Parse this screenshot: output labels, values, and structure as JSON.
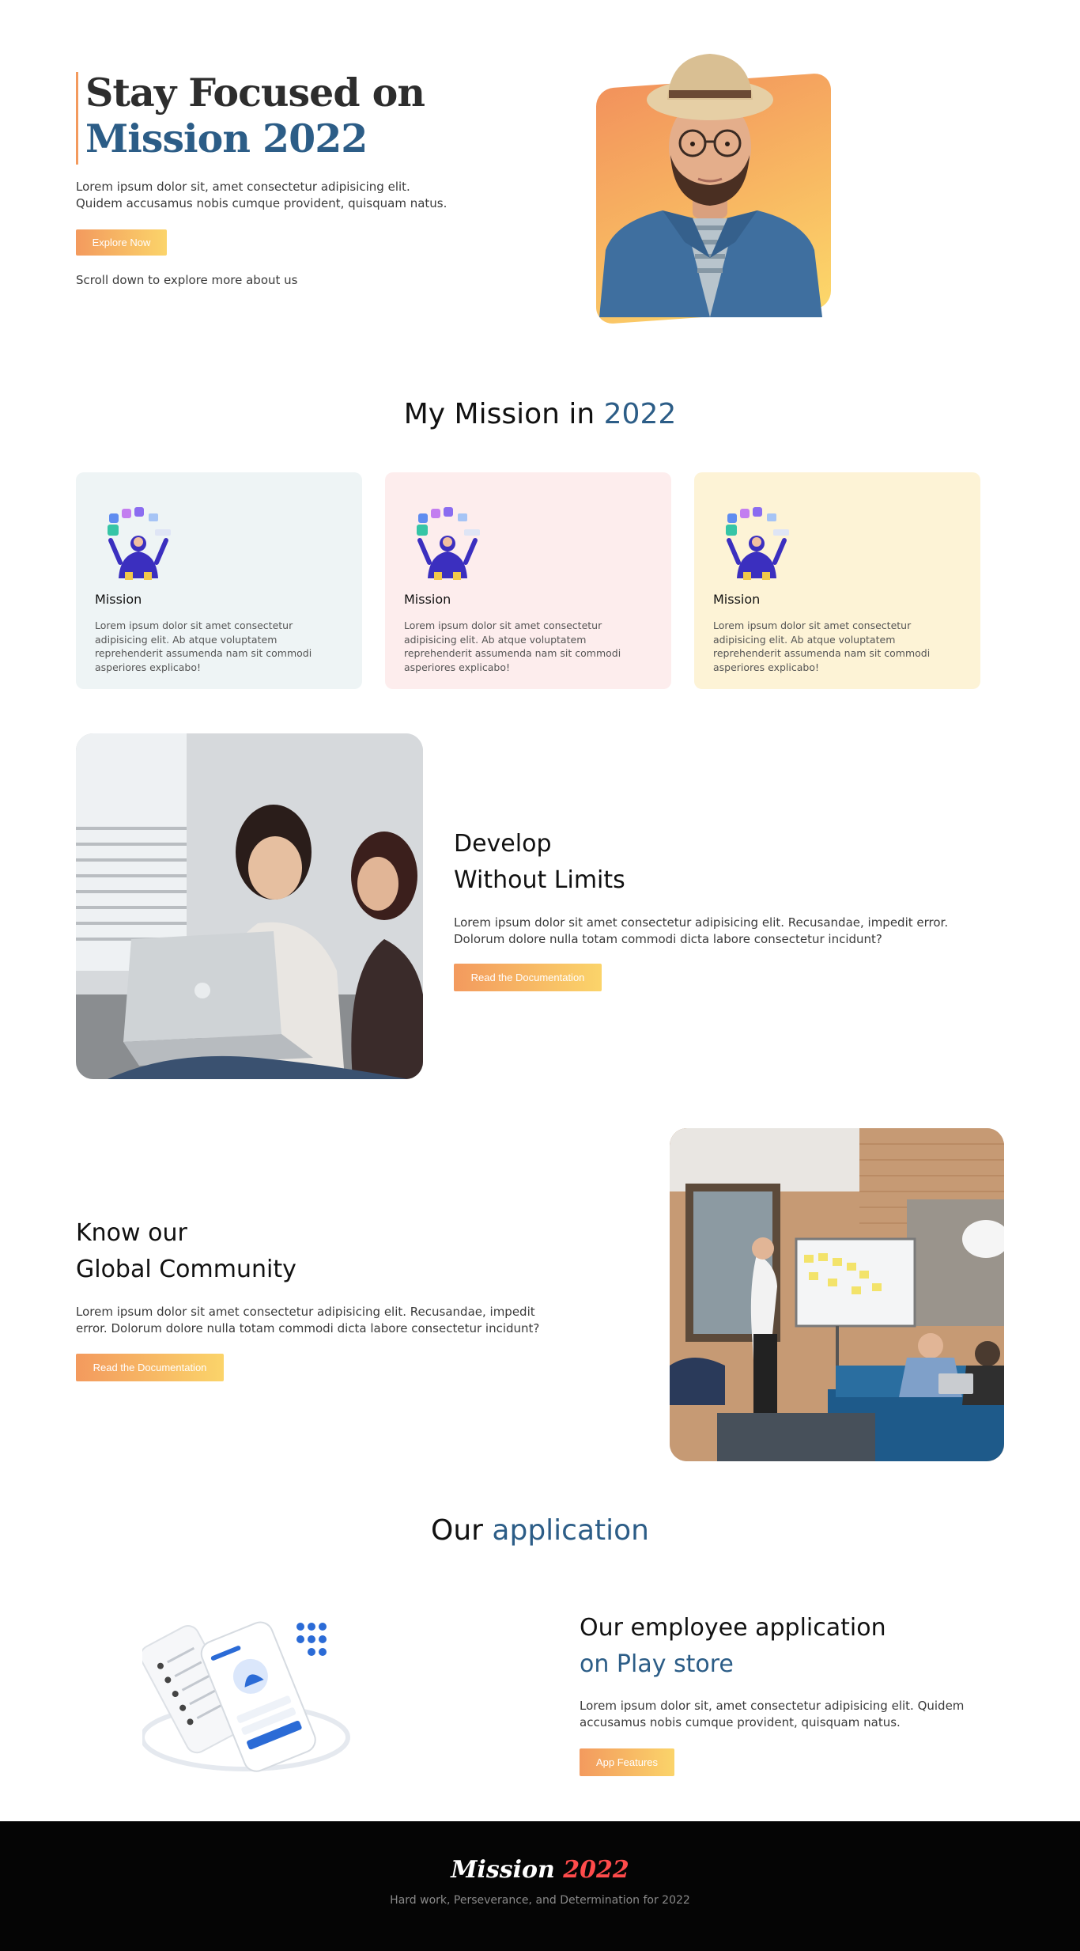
{
  "hero": {
    "title_line1": "Stay Focused on",
    "title_line2": "Mission 2022",
    "description": "Lorem ipsum dolor sit, amet consectetur adipisicing elit. Quidem accusamus nobis cumque provident, quisquam natus.",
    "button_label": "Explore Now",
    "scroll_hint": "Scroll down to explore more about us"
  },
  "mission": {
    "title_prefix": "My Mission in",
    "title_accent": "2022",
    "cards": [
      {
        "title": "Mission",
        "text": "Lorem ipsum dolor sit amet consectetur adipisicing elit. Ab atque voluptatem reprehenderit assumenda nam sit commodi asperiores explicabo!",
        "bg": "#eef4f5"
      },
      {
        "title": "Mission",
        "text": "Lorem ipsum dolor sit amet consectetur adipisicing elit. Ab atque voluptatem reprehenderit assumenda nam sit commodi asperiores explicabo!",
        "bg": "#fdeded"
      },
      {
        "title": "Mission",
        "text": "Lorem ipsum dolor sit amet consectetur adipisicing elit. Ab atque voluptatem reprehenderit assumenda nam sit commodi asperiores explicabo!",
        "bg": "#fdf3d6"
      }
    ]
  },
  "develop": {
    "title_line1": "Develop",
    "title_line2": "Without Limits",
    "text": "Lorem ipsum dolor sit amet consectetur adipisicing elit. Recusandae, impedit error. Dolorum dolore nulla totam commodi dicta labore consectetur incidunt?",
    "button_label": "Read the Documentation"
  },
  "community": {
    "title_line1": "Know our",
    "title_line2": "Global Community",
    "text": "Lorem ipsum dolor sit amet consectetur adipisicing elit. Recusandae, impedit error. Dolorum dolore nulla totam commodi dicta labore consectetur incidunt?",
    "button_label": "Read the Documentation"
  },
  "application": {
    "title_prefix": "Our",
    "title_accent": "application",
    "heading_line1": "Our employee application",
    "heading_line2": "on Play store",
    "text": "Lorem ipsum dolor sit, amet consectetur adipisicing elit. Quidem accusamus nobis cumque provident, quisquam natus.",
    "button_label": "App Features"
  },
  "footer": {
    "logo_main": "Mission",
    "logo_accent": "2022",
    "tagline": "Hard work, Perseverance, and Determination for 2022"
  },
  "colors": {
    "accent_blue": "#2c5d87",
    "gradient_start": "#f39a5e",
    "gradient_end": "#fbd46a",
    "footer_accent": "#ff4b4b"
  }
}
